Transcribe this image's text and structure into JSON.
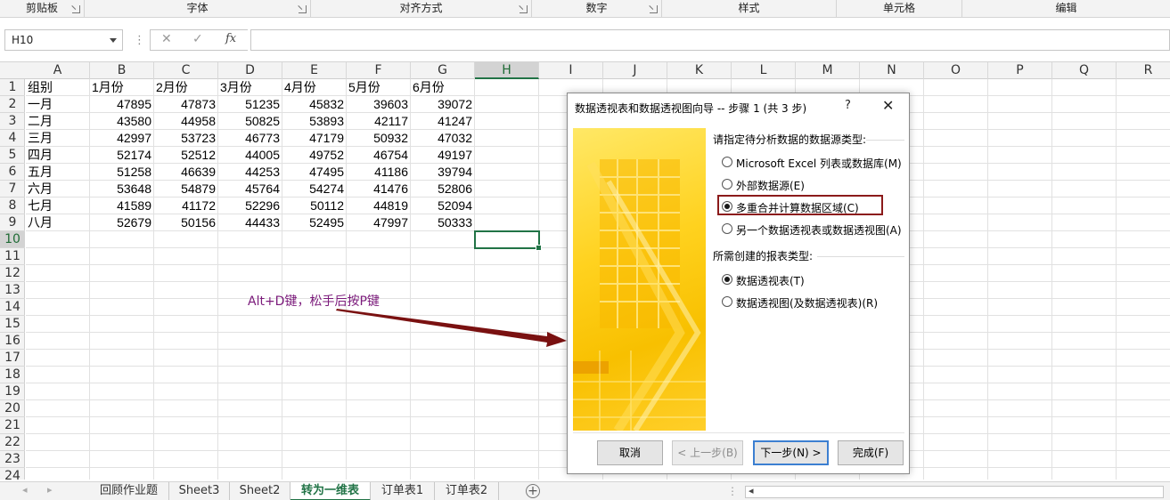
{
  "ribbon": {
    "groups": [
      {
        "label": "剪贴板",
        "launcher": true
      },
      {
        "label": "字体",
        "launcher": true
      },
      {
        "label": "对齐方式",
        "launcher": true
      },
      {
        "label": "数字",
        "launcher": true
      },
      {
        "label": "样式",
        "launcher": false
      },
      {
        "label": "单元格",
        "launcher": false
      },
      {
        "label": "编辑",
        "launcher": false
      }
    ]
  },
  "formula_bar": {
    "name_box": "H10",
    "sep": "⋮",
    "cancel": "✕",
    "enter": "✓",
    "fx": "fx",
    "value": ""
  },
  "columns": [
    "A",
    "B",
    "C",
    "D",
    "E",
    "F",
    "G",
    "H",
    "I",
    "J",
    "K",
    "L",
    "M",
    "N",
    "O",
    "P",
    "Q",
    "R"
  ],
  "selected_column": "H",
  "rows": [
    "1",
    "2",
    "3",
    "4",
    "5",
    "6",
    "7",
    "8",
    "9",
    "10",
    "11",
    "12",
    "13",
    "14",
    "15",
    "16",
    "17",
    "18",
    "19",
    "20",
    "21",
    "22",
    "23",
    "24"
  ],
  "selected_row": "10",
  "table": {
    "header": [
      "组别",
      "1月份",
      "2月份",
      "3月份",
      "4月份",
      "5月份",
      "6月份"
    ],
    "rows": [
      [
        "一月",
        "47895",
        "47873",
        "51235",
        "45832",
        "39603",
        "39072"
      ],
      [
        "二月",
        "43580",
        "44958",
        "50825",
        "53893",
        "42117",
        "41247"
      ],
      [
        "三月",
        "42997",
        "53723",
        "46773",
        "47179",
        "50932",
        "47032"
      ],
      [
        "四月",
        "52174",
        "52512",
        "44005",
        "49752",
        "46754",
        "49197"
      ],
      [
        "五月",
        "51258",
        "46639",
        "44253",
        "47495",
        "41186",
        "39794"
      ],
      [
        "六月",
        "53648",
        "54879",
        "45764",
        "54274",
        "41476",
        "52806"
      ],
      [
        "七月",
        "41589",
        "41172",
        "52296",
        "50112",
        "44819",
        "52094"
      ],
      [
        "八月",
        "52679",
        "50156",
        "44433",
        "52495",
        "47997",
        "50333"
      ]
    ]
  },
  "annotation": "Alt+D键，松手后按P键",
  "sheet_tabs": [
    {
      "label": "回顾作业题",
      "active": false
    },
    {
      "label": "Sheet3",
      "active": false
    },
    {
      "label": "Sheet2",
      "active": false
    },
    {
      "label": "转为一维表",
      "active": true
    },
    {
      "label": "订单表1",
      "active": false
    },
    {
      "label": "订单表2",
      "active": false
    }
  ],
  "dialog": {
    "title": "数据透视表和数据透视图向导 -- 步骤 1 (共 3 步)",
    "help": "?",
    "close": "✕",
    "section1": "请指定待分析数据的数据源类型:",
    "source_options": [
      {
        "label": "Microsoft Excel 列表或数据库(M)",
        "selected": false
      },
      {
        "label": "外部数据源(E)",
        "selected": false
      },
      {
        "label": "多重合并计算数据区域(C)",
        "selected": true
      },
      {
        "label": "另一个数据透视表或数据透视图(A)",
        "selected": false
      }
    ],
    "section2": "所需创建的报表类型:",
    "report_options": [
      {
        "label": "数据透视表(T)",
        "selected": true
      },
      {
        "label": "数据透视图(及数据透视表)(R)",
        "selected": false
      }
    ],
    "buttons": {
      "cancel": "取消",
      "back": "< 上一步(B)",
      "next": "下一步(N) >",
      "finish": "完成(F)"
    }
  },
  "colors": {
    "accent": "#217346",
    "highlight_box": "#8b1a1a",
    "annotation_text": "#7b1a7b",
    "arrow": "#7a1111"
  }
}
